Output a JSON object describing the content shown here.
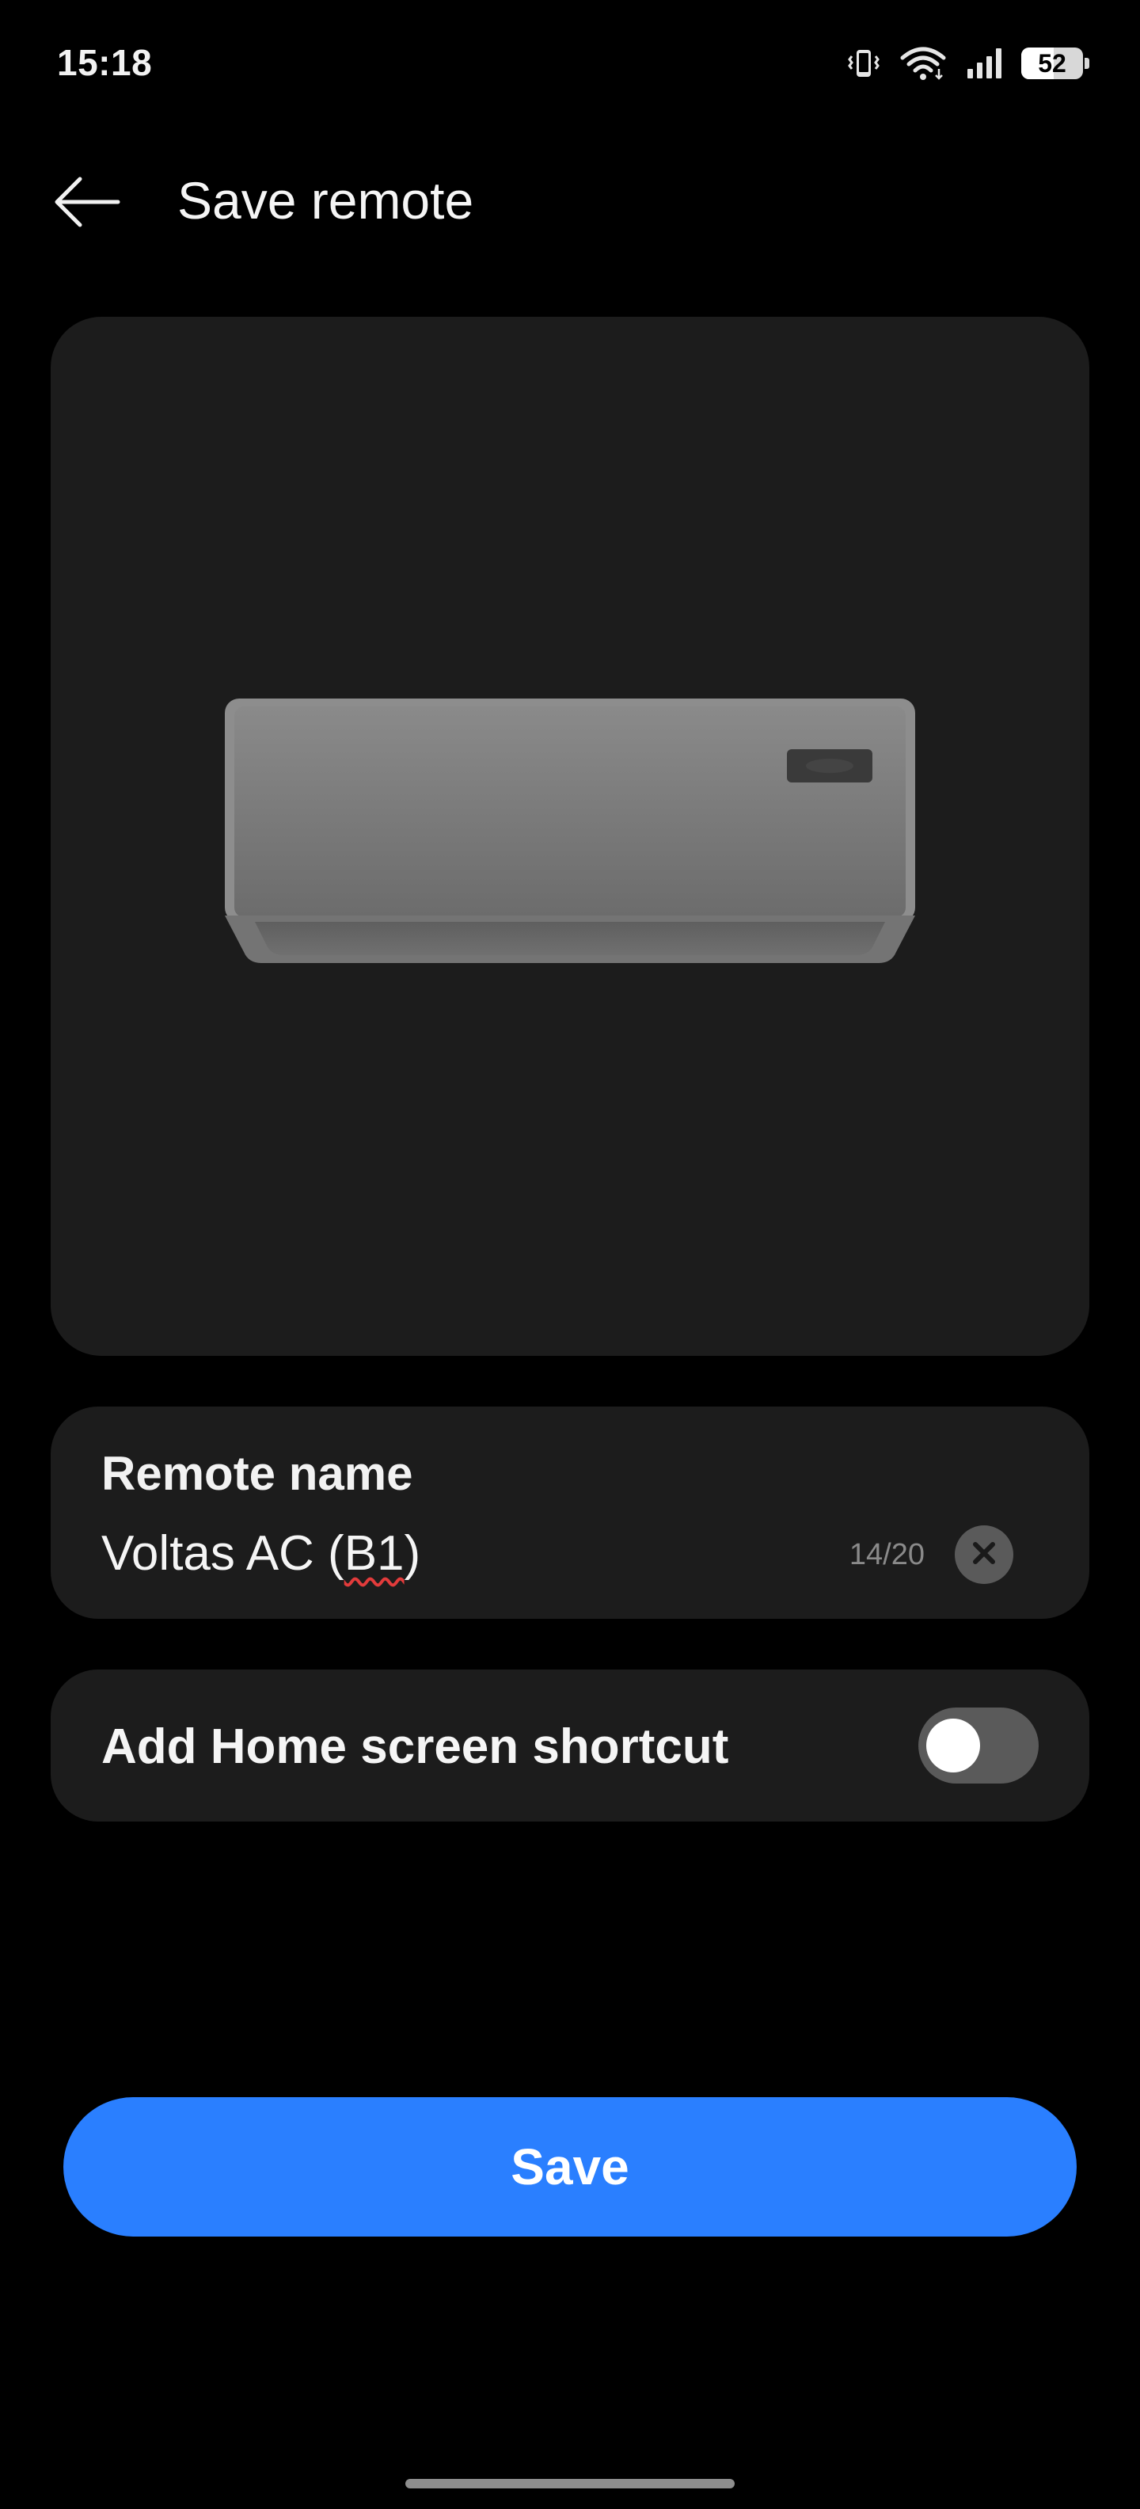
{
  "status_bar": {
    "time": "15:18",
    "battery_percent": 52,
    "battery_label": "52",
    "icons": [
      "vibrate-icon",
      "wifi-icon",
      "signal-icon",
      "battery-icon"
    ]
  },
  "header": {
    "back_icon": "arrow-left-icon",
    "title": "Save remote"
  },
  "preview": {
    "image": "air-conditioner-illustration"
  },
  "remote_name": {
    "label": "Remote name",
    "value_prefix": "Voltas AC (",
    "value_misspelled": "B1",
    "value_suffix": ")",
    "counter": "14/20",
    "clear_icon": "close-icon"
  },
  "shortcut": {
    "label": "Add Home screen shortcut",
    "enabled": false
  },
  "actions": {
    "save_label": "Save"
  },
  "colors": {
    "background": "#000000",
    "card": "#1c1c1c",
    "accent": "#2a7fff",
    "toggle_off": "#5a5a5a",
    "spellcheck": "#e23b3b"
  }
}
